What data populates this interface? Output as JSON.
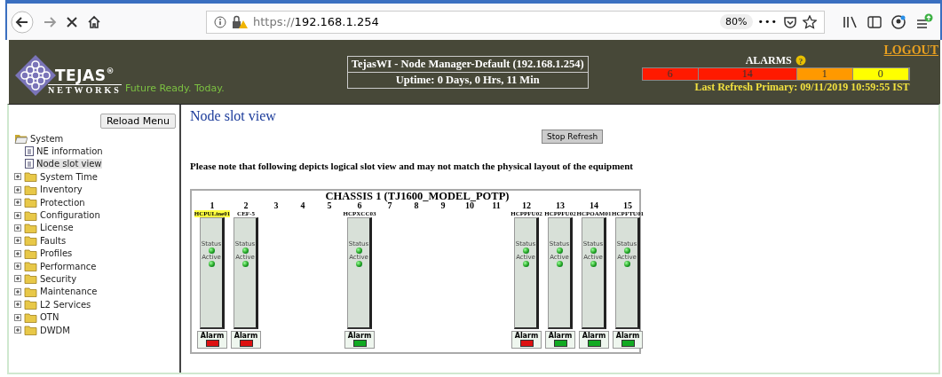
{
  "browser": {
    "url_prefix": "https://",
    "url_host": "192.168.1.254",
    "zoom": "80%",
    "more": "•••"
  },
  "header": {
    "logo_word": "TEJAS",
    "logo_mark": "®",
    "logo_sub": "NETWORKS",
    "tagline": "Future Ready. Today.",
    "title": "TejasWI - Node Manager-Default (192.168.1.254)",
    "uptime": "Uptime: 0 Days, 0 Hrs, 11 Min",
    "alarms_label": "ALARMS",
    "help_icon": "?",
    "alarm_counts": [
      {
        "count": "6",
        "color": "#ff1a00"
      },
      {
        "count": "14",
        "color": "#ff1a00"
      },
      {
        "count": "1",
        "color": "#ff9900"
      },
      {
        "count": "0",
        "color": "#ffff00"
      }
    ],
    "refresh_label": "Last Refresh Primary:",
    "refresh_time": "09/11/2019 10:59:55 IST",
    "logout": "LOGOUT"
  },
  "sidebar": {
    "reload": "Reload Menu",
    "tree": [
      {
        "label": "System",
        "expanded": true,
        "children": [
          {
            "label": "NE information",
            "selected": false
          },
          {
            "label": "Node slot view",
            "selected": true
          }
        ]
      },
      {
        "label": "System Time",
        "expanded": false
      },
      {
        "label": "Inventory",
        "expanded": false
      },
      {
        "label": "Protection",
        "expanded": false
      },
      {
        "label": "Configuration",
        "expanded": false
      },
      {
        "label": "License",
        "expanded": false
      },
      {
        "label": "Faults",
        "expanded": false
      },
      {
        "label": "Profiles",
        "expanded": false
      },
      {
        "label": "Performance",
        "expanded": false
      },
      {
        "label": "Security",
        "expanded": false
      },
      {
        "label": "Maintenance",
        "expanded": false
      },
      {
        "label": "L2 Services",
        "expanded": false
      },
      {
        "label": "OTN",
        "expanded": false
      },
      {
        "label": "DWDM",
        "expanded": false
      }
    ]
  },
  "main": {
    "title": "Node slot view",
    "stop_refresh": "Stop Refresh",
    "note": "Please note that following depicts logical slot view and may not match the physical layout of the equipment",
    "chassis": {
      "title": "CHASSIS 1 (TJ1600_MODEL_POTP)",
      "slots": [
        {
          "number": "1",
          "card": "HCPULine01",
          "highlighted": true,
          "status": "Status",
          "active": "Active",
          "alarm": "Alarm",
          "color": "#dd1111"
        },
        {
          "number": "2",
          "card": "CEF-5",
          "highlighted": false,
          "status": "Status",
          "active": "Active",
          "alarm": "Alarm",
          "color": "#dd1111"
        },
        {
          "number": "3"
        },
        {
          "number": "4"
        },
        {
          "number": "5"
        },
        {
          "number": "6",
          "card": "HCPXCC03",
          "highlighted": false,
          "status": "Status",
          "active": "Active",
          "alarm": "Alarm",
          "color": "#11aa22"
        },
        {
          "number": "7"
        },
        {
          "number": "8"
        },
        {
          "number": "9"
        },
        {
          "number": "10"
        },
        {
          "number": "11"
        },
        {
          "number": "12",
          "card": "HCPPFU02",
          "highlighted": false,
          "status": "Status",
          "active": "Active",
          "alarm": "Alarm",
          "color": "#dd1111"
        },
        {
          "number": "13",
          "card": "HCPPFU02",
          "highlighted": false,
          "status": "Status",
          "active": "Active",
          "alarm": "Alarm",
          "color": "#11aa22"
        },
        {
          "number": "14",
          "card": "HCPOAM01",
          "highlighted": false,
          "status": "Status",
          "active": "Active",
          "alarm": "Alarm",
          "color": "#11aa22"
        },
        {
          "number": "15",
          "card": "HCPFTU01",
          "highlighted": false,
          "status": "Status",
          "active": "Active",
          "alarm": "Alarm",
          "color": "#11aa22"
        }
      ]
    }
  }
}
